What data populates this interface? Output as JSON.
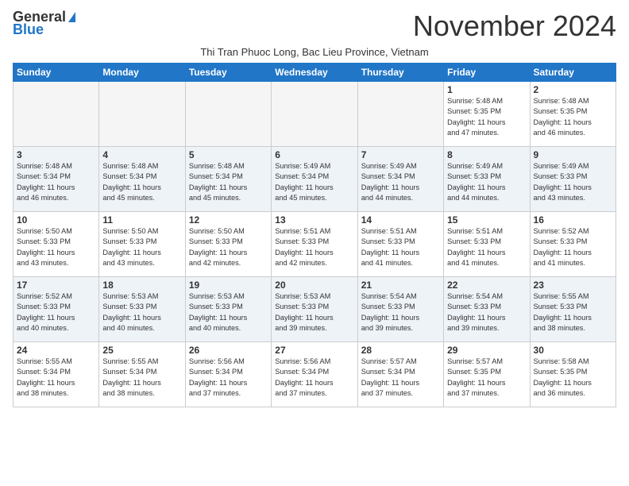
{
  "logo": {
    "line1": "General",
    "line2": "Blue"
  },
  "title": "November 2024",
  "subtitle": "Thi Tran Phuoc Long, Bac Lieu Province, Vietnam",
  "days_of_week": [
    "Sunday",
    "Monday",
    "Tuesday",
    "Wednesday",
    "Thursday",
    "Friday",
    "Saturday"
  ],
  "weeks": [
    [
      {
        "day": "",
        "info": ""
      },
      {
        "day": "",
        "info": ""
      },
      {
        "day": "",
        "info": ""
      },
      {
        "day": "",
        "info": ""
      },
      {
        "day": "",
        "info": ""
      },
      {
        "day": "1",
        "info": "Sunrise: 5:48 AM\nSunset: 5:35 PM\nDaylight: 11 hours\nand 47 minutes."
      },
      {
        "day": "2",
        "info": "Sunrise: 5:48 AM\nSunset: 5:35 PM\nDaylight: 11 hours\nand 46 minutes."
      }
    ],
    [
      {
        "day": "3",
        "info": "Sunrise: 5:48 AM\nSunset: 5:34 PM\nDaylight: 11 hours\nand 46 minutes."
      },
      {
        "day": "4",
        "info": "Sunrise: 5:48 AM\nSunset: 5:34 PM\nDaylight: 11 hours\nand 45 minutes."
      },
      {
        "day": "5",
        "info": "Sunrise: 5:48 AM\nSunset: 5:34 PM\nDaylight: 11 hours\nand 45 minutes."
      },
      {
        "day": "6",
        "info": "Sunrise: 5:49 AM\nSunset: 5:34 PM\nDaylight: 11 hours\nand 45 minutes."
      },
      {
        "day": "7",
        "info": "Sunrise: 5:49 AM\nSunset: 5:34 PM\nDaylight: 11 hours\nand 44 minutes."
      },
      {
        "day": "8",
        "info": "Sunrise: 5:49 AM\nSunset: 5:33 PM\nDaylight: 11 hours\nand 44 minutes."
      },
      {
        "day": "9",
        "info": "Sunrise: 5:49 AM\nSunset: 5:33 PM\nDaylight: 11 hours\nand 43 minutes."
      }
    ],
    [
      {
        "day": "10",
        "info": "Sunrise: 5:50 AM\nSunset: 5:33 PM\nDaylight: 11 hours\nand 43 minutes."
      },
      {
        "day": "11",
        "info": "Sunrise: 5:50 AM\nSunset: 5:33 PM\nDaylight: 11 hours\nand 43 minutes."
      },
      {
        "day": "12",
        "info": "Sunrise: 5:50 AM\nSunset: 5:33 PM\nDaylight: 11 hours\nand 42 minutes."
      },
      {
        "day": "13",
        "info": "Sunrise: 5:51 AM\nSunset: 5:33 PM\nDaylight: 11 hours\nand 42 minutes."
      },
      {
        "day": "14",
        "info": "Sunrise: 5:51 AM\nSunset: 5:33 PM\nDaylight: 11 hours\nand 41 minutes."
      },
      {
        "day": "15",
        "info": "Sunrise: 5:51 AM\nSunset: 5:33 PM\nDaylight: 11 hours\nand 41 minutes."
      },
      {
        "day": "16",
        "info": "Sunrise: 5:52 AM\nSunset: 5:33 PM\nDaylight: 11 hours\nand 41 minutes."
      }
    ],
    [
      {
        "day": "17",
        "info": "Sunrise: 5:52 AM\nSunset: 5:33 PM\nDaylight: 11 hours\nand 40 minutes."
      },
      {
        "day": "18",
        "info": "Sunrise: 5:53 AM\nSunset: 5:33 PM\nDaylight: 11 hours\nand 40 minutes."
      },
      {
        "day": "19",
        "info": "Sunrise: 5:53 AM\nSunset: 5:33 PM\nDaylight: 11 hours\nand 40 minutes."
      },
      {
        "day": "20",
        "info": "Sunrise: 5:53 AM\nSunset: 5:33 PM\nDaylight: 11 hours\nand 39 minutes."
      },
      {
        "day": "21",
        "info": "Sunrise: 5:54 AM\nSunset: 5:33 PM\nDaylight: 11 hours\nand 39 minutes."
      },
      {
        "day": "22",
        "info": "Sunrise: 5:54 AM\nSunset: 5:33 PM\nDaylight: 11 hours\nand 39 minutes."
      },
      {
        "day": "23",
        "info": "Sunrise: 5:55 AM\nSunset: 5:33 PM\nDaylight: 11 hours\nand 38 minutes."
      }
    ],
    [
      {
        "day": "24",
        "info": "Sunrise: 5:55 AM\nSunset: 5:34 PM\nDaylight: 11 hours\nand 38 minutes."
      },
      {
        "day": "25",
        "info": "Sunrise: 5:55 AM\nSunset: 5:34 PM\nDaylight: 11 hours\nand 38 minutes."
      },
      {
        "day": "26",
        "info": "Sunrise: 5:56 AM\nSunset: 5:34 PM\nDaylight: 11 hours\nand 37 minutes."
      },
      {
        "day": "27",
        "info": "Sunrise: 5:56 AM\nSunset: 5:34 PM\nDaylight: 11 hours\nand 37 minutes."
      },
      {
        "day": "28",
        "info": "Sunrise: 5:57 AM\nSunset: 5:34 PM\nDaylight: 11 hours\nand 37 minutes."
      },
      {
        "day": "29",
        "info": "Sunrise: 5:57 AM\nSunset: 5:35 PM\nDaylight: 11 hours\nand 37 minutes."
      },
      {
        "day": "30",
        "info": "Sunrise: 5:58 AM\nSunset: 5:35 PM\nDaylight: 11 hours\nand 36 minutes."
      }
    ]
  ]
}
